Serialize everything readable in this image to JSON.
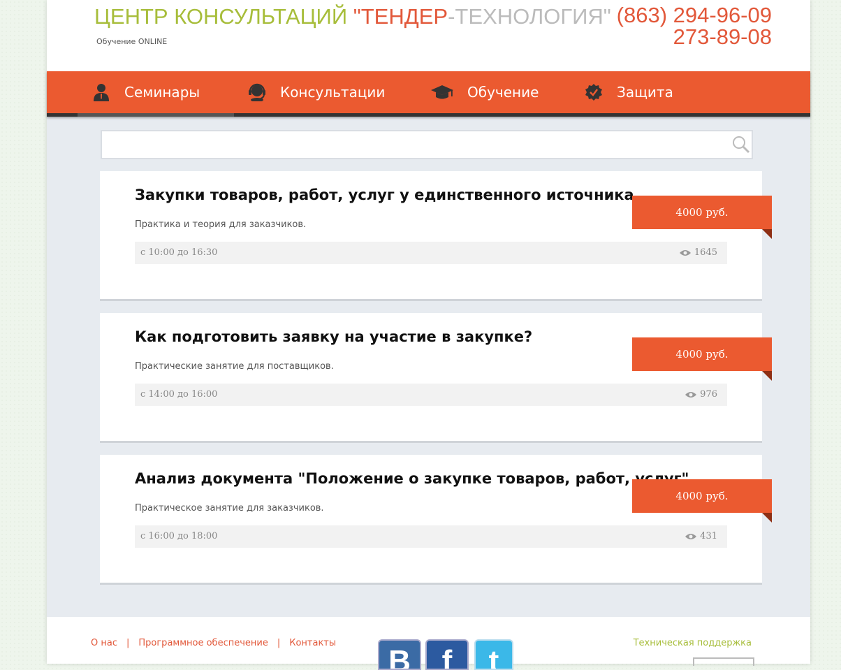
{
  "header": {
    "brand_part1": "ЦЕНТР КОНСУЛЬТАЦИЙ ",
    "brand_part2": "\"ТЕНДЕР",
    "brand_part3": "-ТЕХНОЛОГИЯ\"",
    "subtitle": "Обучение ONLINE",
    "phone1": "(863) 294-96-09",
    "phone2": "273-89-08"
  },
  "nav": {
    "items": [
      {
        "label": "Семинары",
        "icon": "user-icon",
        "active": true
      },
      {
        "label": "Консультации",
        "icon": "headset-icon",
        "active": false
      },
      {
        "label": "Обучение",
        "icon": "graduation-cap-icon",
        "active": false
      },
      {
        "label": "Защита",
        "icon": "check-badge-icon",
        "active": false
      }
    ]
  },
  "search": {
    "value": "",
    "placeholder": ""
  },
  "cards": [
    {
      "title": "Закупки товаров, работ, услуг у единственного источника",
      "desc": "Практика и теория для заказчиков.",
      "time": "с 10:00 до 16:30",
      "views": "1645",
      "price": "4000 руб."
    },
    {
      "title": "Как подготовить заявку на участие в закупке?",
      "desc": "Практические занятие для поставщиков.",
      "time": "с 14:00 до 16:00",
      "views": "976",
      "price": "4000 руб."
    },
    {
      "title": "Анализ документа \"Положение о закупке товаров, работ, услуг\"",
      "desc": "Практическое занятие для заказчиков.",
      "time": "с 16:00 до 18:00",
      "views": "431",
      "price": "4000 руб."
    }
  ],
  "footer": {
    "links": [
      "О нас",
      "Программное обеспечение",
      "Контакты"
    ],
    "separator": "|",
    "support": "Техническая поддержка",
    "social": [
      {
        "name": "vk-icon",
        "glyph": "B",
        "color": "#3b6ba5"
      },
      {
        "name": "facebook-icon",
        "glyph": "f",
        "color": "#2c5aa0"
      },
      {
        "name": "twitter-icon",
        "glyph": "t",
        "color": "#3bb8e8"
      }
    ]
  },
  "colors": {
    "accent": "#eb5a30",
    "green": "#a7bd3a",
    "gray": "#bbbbbb",
    "nav_underline": "#333333"
  }
}
